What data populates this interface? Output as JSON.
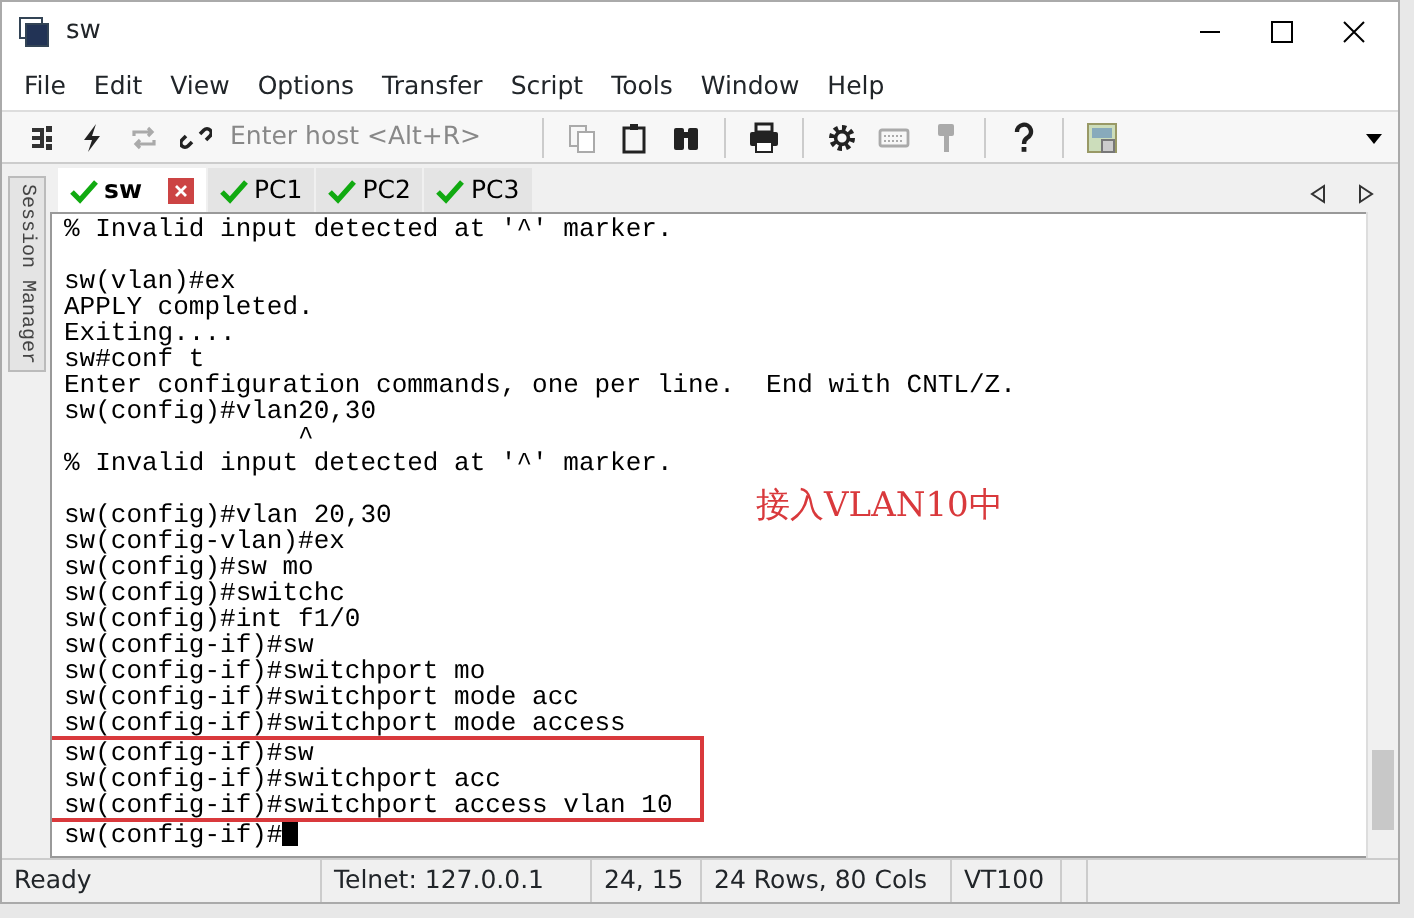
{
  "window": {
    "title": "sw"
  },
  "menu": [
    "File",
    "Edit",
    "View",
    "Options",
    "Transfer",
    "Script",
    "Tools",
    "Window",
    "Help"
  ],
  "toolbar": {
    "host_field": {
      "placeholder": "Enter host <Alt+R>"
    },
    "buttons": [
      {
        "kind": "connect",
        "disabled": false
      },
      {
        "kind": "quick",
        "disabled": false
      },
      {
        "kind": "reconnect",
        "disabled": true
      },
      {
        "kind": "link",
        "disabled": false
      },
      {
        "kind": "sep"
      },
      {
        "kind": "copy",
        "disabled": true
      },
      {
        "kind": "paste",
        "disabled": false
      },
      {
        "kind": "find",
        "disabled": false
      },
      {
        "kind": "sep"
      },
      {
        "kind": "print",
        "disabled": false
      },
      {
        "kind": "sep"
      },
      {
        "kind": "settings",
        "disabled": false
      },
      {
        "kind": "keyboard",
        "disabled": true
      },
      {
        "kind": "key",
        "disabled": true
      },
      {
        "kind": "sep"
      },
      {
        "kind": "help",
        "disabled": false
      },
      {
        "kind": "sep"
      },
      {
        "kind": "keymap",
        "disabled": false
      }
    ]
  },
  "tabs": [
    {
      "label": "sw",
      "selected": true,
      "connected": true
    },
    {
      "label": "PC1",
      "selected": false,
      "connected": true
    },
    {
      "label": "PC2",
      "selected": false,
      "connected": true
    },
    {
      "label": "PC3",
      "selected": false,
      "connected": true
    }
  ],
  "session_manager": {
    "label": "Session Manager"
  },
  "terminal": {
    "lines": [
      {
        "text": "% Invalid input detected at '^' marker.",
        "gap_after": true,
        "boxed": false
      },
      {
        "text": "sw(vlan)#ex",
        "gap_after": false,
        "boxed": false
      },
      {
        "text": "APPLY completed.",
        "gap_after": false,
        "boxed": false
      },
      {
        "text": "Exiting....",
        "gap_after": false,
        "boxed": false
      },
      {
        "text": "sw#conf t",
        "gap_after": false,
        "boxed": false
      },
      {
        "text": "Enter configuration commands, one per line.  End with CNTL/Z.",
        "gap_after": false,
        "boxed": false
      },
      {
        "text": "sw(config)#vlan20,30",
        "gap_after": false,
        "boxed": false
      },
      {
        "text": "               ^",
        "gap_after": false,
        "boxed": false
      },
      {
        "text": "% Invalid input detected at '^' marker.",
        "gap_after": true,
        "boxed": false
      },
      {
        "text": "sw(config)#vlan 20,30",
        "gap_after": false,
        "boxed": false
      },
      {
        "text": "sw(config-vlan)#ex",
        "gap_after": false,
        "boxed": false
      },
      {
        "text": "sw(config)#sw mo",
        "gap_after": false,
        "boxed": false
      },
      {
        "text": "sw(config)#switchc",
        "gap_after": false,
        "boxed": false
      },
      {
        "text": "sw(config)#int f1/0",
        "gap_after": false,
        "boxed": false
      },
      {
        "text": "sw(config-if)#sw",
        "gap_after": false,
        "boxed": false
      },
      {
        "text": "sw(config-if)#switchport mo",
        "gap_after": false,
        "boxed": false
      },
      {
        "text": "sw(config-if)#switchport mode acc",
        "gap_after": false,
        "boxed": false
      },
      {
        "text": "sw(config-if)#switchport mode access",
        "gap_after": false,
        "boxed": false
      },
      {
        "text": "sw(config-if)#sw",
        "gap_after": false,
        "boxed": true
      },
      {
        "text": "sw(config-if)#switchport acc",
        "gap_after": false,
        "boxed": true
      },
      {
        "text": "sw(config-if)#switchport access vlan 10",
        "gap_after": false,
        "boxed": true
      },
      {
        "text": "sw(config-if)#",
        "gap_after": false,
        "boxed": false,
        "cursor": true
      }
    ],
    "annotation": "接入VLAN10中"
  },
  "status_bar": [
    "Ready",
    "Telnet: 127.0.0.1",
    "24,  15",
    "24 Rows, 80 Cols",
    "VT100"
  ]
}
